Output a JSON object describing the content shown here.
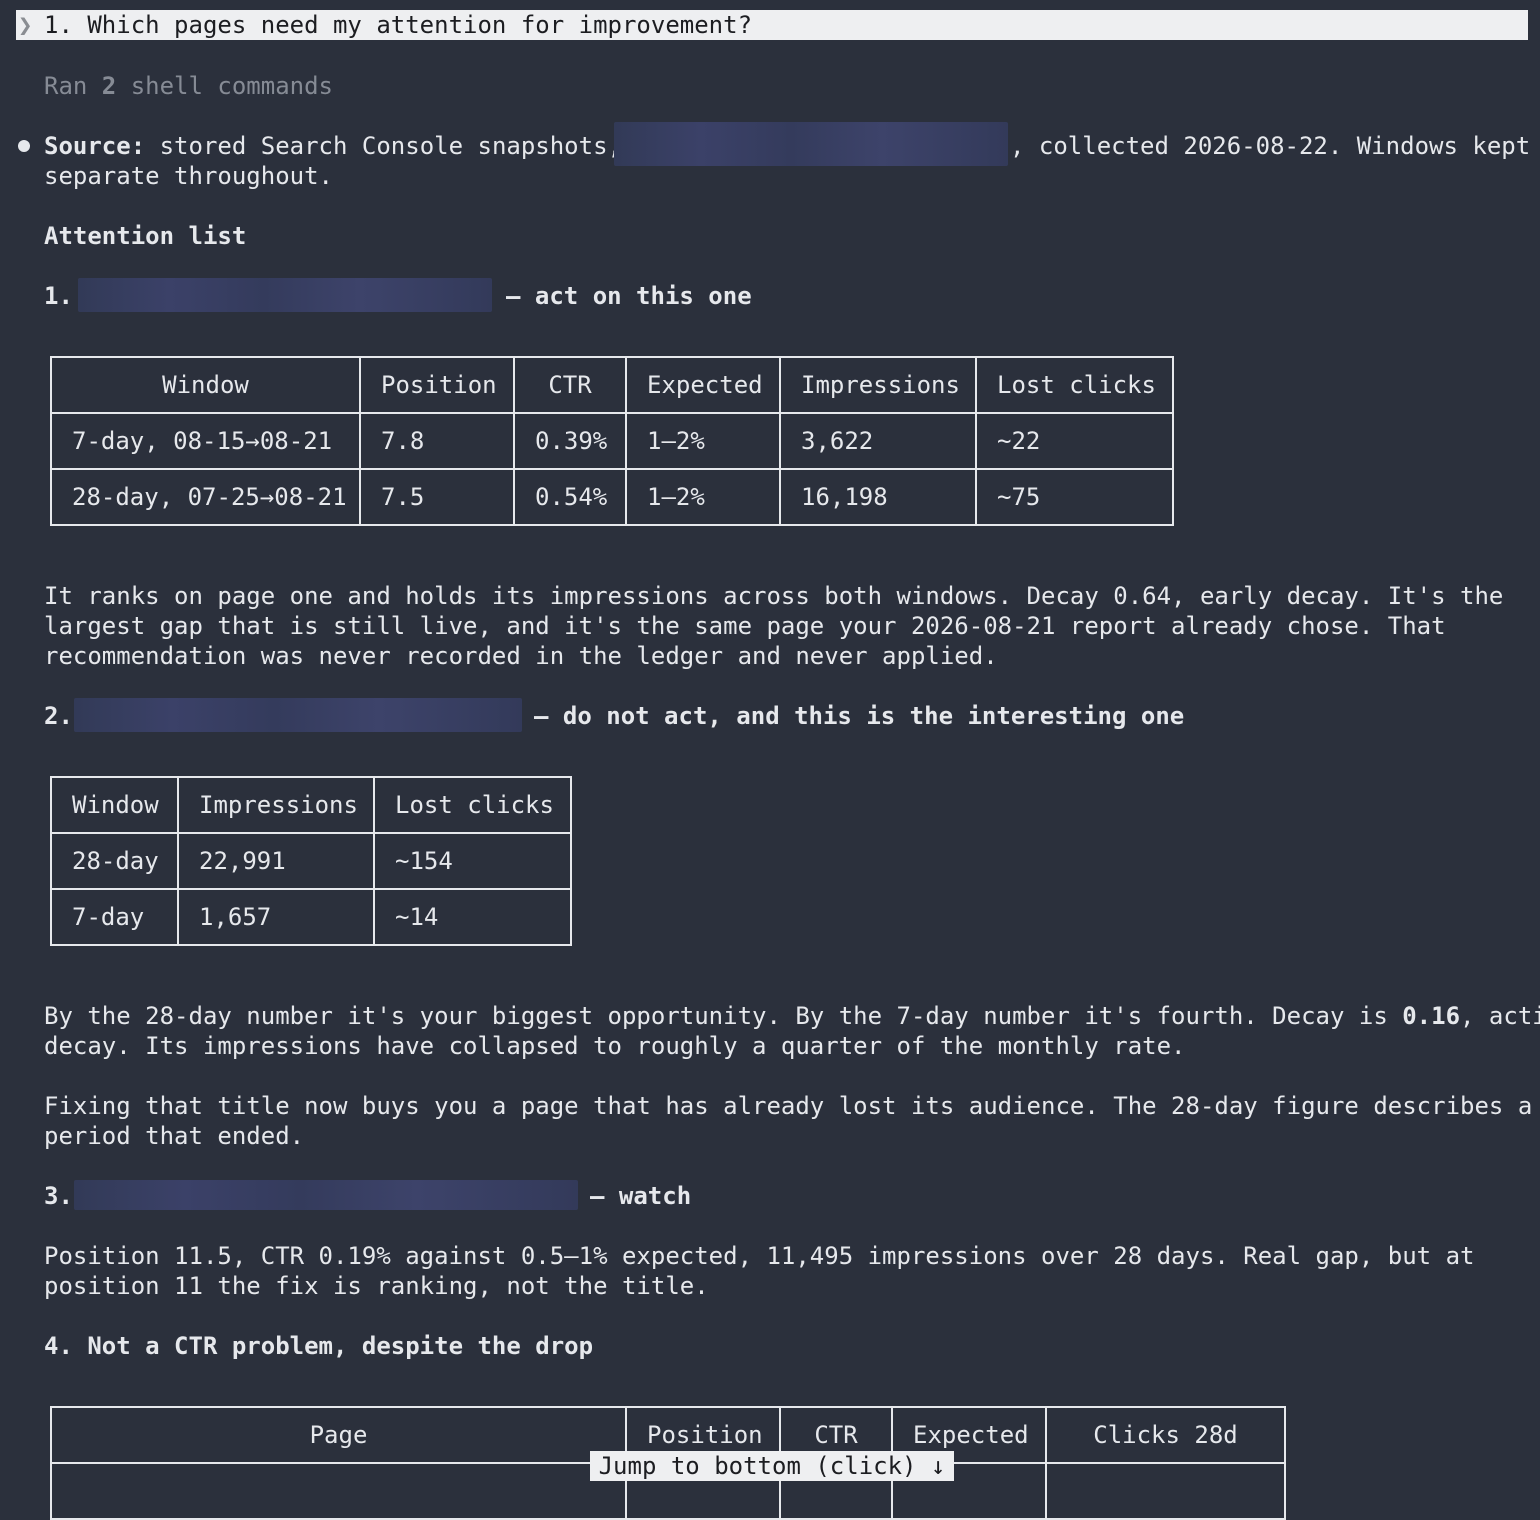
{
  "prompt": {
    "text": "1. Which pages need my attention for improvement?"
  },
  "ran": {
    "prefix": "Ran ",
    "count": "2",
    "suffix": " shell commands"
  },
  "source": {
    "label": "Source:",
    "text1": " stored Search Console snapshots,",
    "text2": ", collected 2026-08-22. Windows kept",
    "line2": "separate throughout."
  },
  "attention_heading": "Attention list",
  "item1": {
    "num": "1.",
    "tag": "— act on this one",
    "table": {
      "headers": [
        "Window",
        "Position",
        "CTR",
        "Expected",
        "Impressions",
        "Lost clicks"
      ],
      "rows": [
        [
          "7-day, 08-15→08-21",
          "7.8",
          "0.39%",
          "1–2%",
          "3,622",
          "~22"
        ],
        [
          "28-day, 07-25→08-21",
          "7.5",
          "0.54%",
          "1–2%",
          "16,198",
          "~75"
        ]
      ]
    },
    "para": [
      "It ranks on page one and holds its impressions across both windows. Decay 0.64, early decay. It's the",
      "largest gap that is still live, and it's the same page your 2026-08-21 report already chose. That",
      "recommendation was never recorded in the ledger and never applied."
    ]
  },
  "item2": {
    "num": "2.",
    "tag": "— do not act, and this is the interesting one",
    "table": {
      "headers": [
        "Window",
        "Impressions",
        "Lost clicks"
      ],
      "rows": [
        [
          "28-day",
          "22,991",
          "~154"
        ],
        [
          "7-day",
          "1,657",
          "~14"
        ]
      ]
    },
    "para1_line1_a": "By the 28-day number it's your biggest opportunity. By the 7-day number it's fourth. Decay is ",
    "para1_line1_bold": "0.16",
    "para1_line1_c": ", active",
    "para1_line2": "decay. Its impressions have collapsed to roughly a quarter of the monthly rate.",
    "para2": [
      "Fixing that title now buys you a page that has already lost its audience. The 28-day figure describes a",
      "period that ended."
    ]
  },
  "item3": {
    "num": "3.",
    "tag": "— watch",
    "para": [
      "Position 11.5, CTR 0.19% against 0.5–1% expected, 11,495 impressions over 28 days. Real gap, but at",
      "position 11 the fix is ranking, not the title."
    ]
  },
  "item4": {
    "heading": "4. Not a CTR problem, despite the drop",
    "table": {
      "headers": [
        "Page",
        "Position",
        "CTR",
        "Expected",
        "Clicks 28d"
      ]
    }
  },
  "jump_button": "Jump to bottom (click) ↓"
}
